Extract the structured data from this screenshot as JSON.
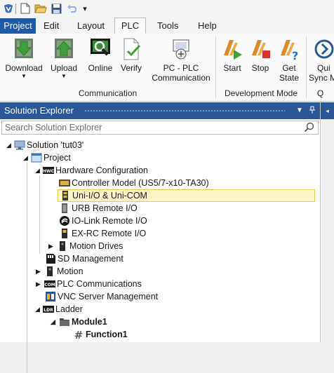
{
  "quick_access": {
    "icons": [
      "app-icon",
      "new-icon",
      "open-icon",
      "save-icon",
      "undo-icon",
      "customize-icon"
    ]
  },
  "menu": {
    "tabs": [
      {
        "label": "Project"
      },
      {
        "label": "Edit"
      },
      {
        "label": "Layout"
      },
      {
        "label": "PLC"
      },
      {
        "label": "Tools"
      },
      {
        "label": "Help"
      }
    ],
    "active": "PLC"
  },
  "ribbon": {
    "buttons": [
      {
        "label": "Download",
        "icon": "download-icon",
        "has_dropdown": true
      },
      {
        "label": "Upload",
        "icon": "upload-icon",
        "has_dropdown": true
      },
      {
        "label": "Online",
        "icon": "online-icon"
      },
      {
        "label": "Verify",
        "icon": "verify-icon"
      },
      {
        "label": "PC - PLC",
        "label2": "Communication",
        "icon": "pc-plc-communication-icon"
      },
      {
        "label": "Start",
        "icon": "start-icon"
      },
      {
        "label": "Stop",
        "icon": "stop-icon"
      },
      {
        "label": "Get",
        "label2": "State",
        "icon": "get-state-icon"
      },
      {
        "label": "Qui",
        "label2": "Sync M",
        "icon": "quick-sync-icon"
      }
    ],
    "groups": [
      {
        "label": "Communication"
      },
      {
        "label": "Development Mode"
      },
      {
        "label": "Q"
      }
    ]
  },
  "solution_explorer": {
    "title": "Solution Explorer",
    "pin_icon": "pin-icon",
    "dropdown_icon": "dropdown-icon",
    "search_placeholder": "Search Solution Explorer",
    "tree": [
      {
        "label": "Solution 'tut03'",
        "icon": "solution-icon",
        "expander": "expanded"
      },
      {
        "label": "Project",
        "icon": "project-icon",
        "expander": "expanded"
      },
      {
        "label": "Hardware Configuration",
        "icon": "hardware-config-icon",
        "expander": "expanded"
      },
      {
        "label": "Controller Model (US5/7-x10-TA30)",
        "icon": "controller-icon"
      },
      {
        "label": "Uni-I/O & Uni-COM",
        "icon": "uni-io-icon",
        "selected": true
      },
      {
        "label": "URB Remote I/O",
        "icon": "urb-icon"
      },
      {
        "label": "IO-Link Remote I/O",
        "icon": "io-link-icon"
      },
      {
        "label": "EX-RC Remote I/O",
        "icon": "ex-rc-icon"
      },
      {
        "label": "Motion Drives",
        "icon": "motion-drives-icon",
        "expander": "collapsed"
      },
      {
        "label": "SD Management",
        "icon": "sd-icon"
      },
      {
        "label": "Motion",
        "icon": "motion-icon",
        "expander": "collapsed"
      },
      {
        "label": "PLC Communications",
        "icon": "plc-comm-icon",
        "expander": "collapsed"
      },
      {
        "label": "VNC Server Management",
        "icon": "vnc-icon"
      },
      {
        "label": "Ladder",
        "icon": "ladder-icon",
        "expander": "expanded"
      },
      {
        "label": "Module1",
        "icon": "folder-icon",
        "expander": "expanded",
        "bold": true
      },
      {
        "label": "Function1",
        "icon": "function-icon",
        "bold": true
      }
    ]
  },
  "colors": {
    "accent": "#2b5697",
    "project_tab": "#1d5aa8",
    "selection_fill": "#fdf6c4",
    "selection_border": "#e6cc5a"
  }
}
